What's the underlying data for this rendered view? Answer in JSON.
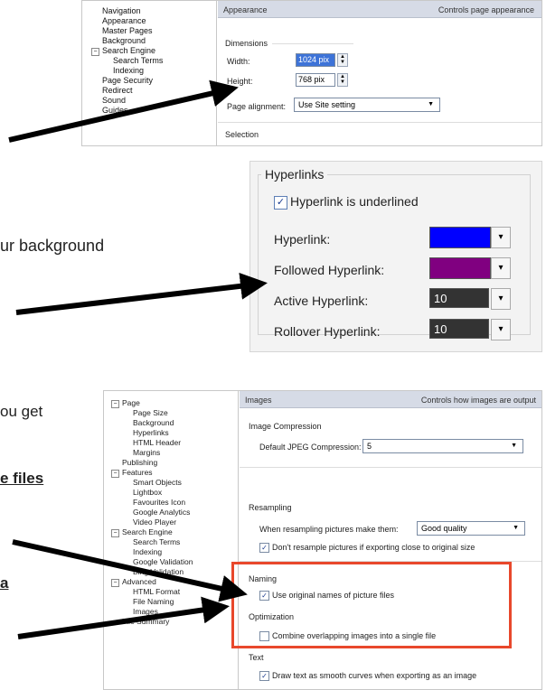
{
  "top_panel": {
    "tree": [
      "Navigation",
      "Appearance",
      "Master Pages",
      "Background",
      "Search Engine",
      "Search Terms",
      "Indexing",
      "Page Security",
      "Redirect",
      "Sound",
      "Guides"
    ],
    "header_title": "Appearance",
    "header_desc": "Controls page appearance",
    "section": "Dimensions",
    "width_label": "Width:",
    "width_value": "1024 pix",
    "height_label": "Height:",
    "height_value": "768 pix",
    "align_label": "Page alignment:",
    "align_value": "Use Site setting",
    "selection": "Selection"
  },
  "hyperlinks_panel": {
    "title": "Hyperlinks",
    "underline_label": "Hyperlink is underlined",
    "rows": [
      {
        "label": "Hyperlink:",
        "swatch": "#0000ff",
        "text": ""
      },
      {
        "label": "Followed Hyperlink:",
        "swatch": "#800080",
        "text": ""
      },
      {
        "label": "Active Hyperlink:",
        "swatch": "#333333",
        "text": "10"
      },
      {
        "label": "Rollover Hyperlink:",
        "swatch": "#333333",
        "text": "10"
      }
    ]
  },
  "doc_text": {
    "line1": "ur background",
    "line2": "ou get",
    "line3": "e files",
    "line4": "a"
  },
  "images_panel": {
    "tree": [
      "Page",
      "Page Size",
      "Background",
      "Hyperlinks",
      "HTML Header",
      "Margins",
      "Publishing",
      "Features",
      "Smart Objects",
      "Lightbox",
      "Favourites Icon",
      "Google Analytics",
      "Video Player",
      "Search Engine",
      "Search Terms",
      "Indexing",
      "Google Validation",
      "Bing Validation",
      "Advanced",
      "HTML Format",
      "File Naming",
      "Images",
      "File Summary"
    ],
    "header_title": "Images",
    "header_desc": "Controls how images are output",
    "compression_section": "Image Compression",
    "jpeg_label": "Default JPEG Compression:",
    "jpeg_value": "5",
    "resampling_section": "Resampling",
    "resample_label": "When resampling pictures make them:",
    "resample_value": "Good quality",
    "no_resample_label": "Don't resample pictures if exporting close to original size",
    "naming_section": "Naming",
    "naming_label": "Use original names of picture files",
    "optimization_section": "Optimization",
    "combine_label": "Combine overlapping images into a single file",
    "text_section": "Text",
    "smooth_label": "Draw text as smooth curves when exporting as an image"
  },
  "colors": {
    "highlight_red": "#e8482c",
    "arrow": "#000000",
    "selection_blue": "#3d73d8"
  }
}
